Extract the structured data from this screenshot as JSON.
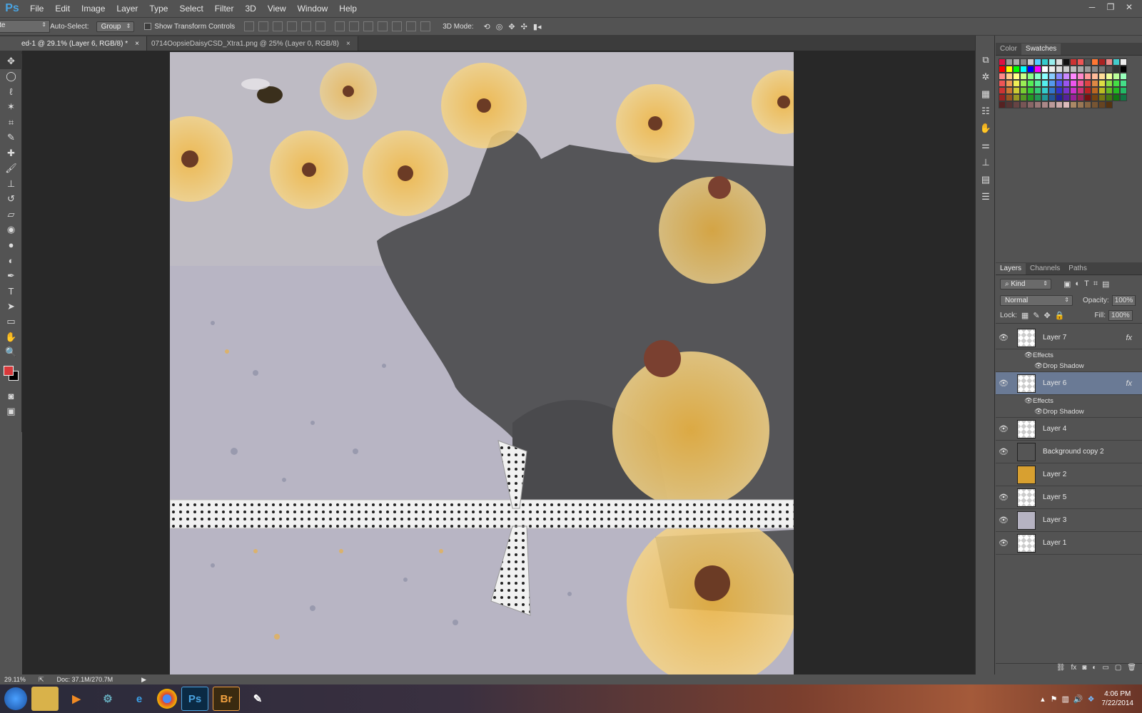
{
  "app": {
    "logo": "Ps"
  },
  "menu": [
    "File",
    "Edit",
    "Image",
    "Layer",
    "Type",
    "Select",
    "Filter",
    "3D",
    "View",
    "Window",
    "Help"
  ],
  "options": {
    "auto_select_label": "Auto-Select:",
    "auto_select_value": "Group",
    "transform_label": "Show Transform Controls",
    "mode_3d_label": "3D Mode:",
    "workspace": "Annette"
  },
  "tabs": [
    {
      "label": "ed-1 @ 29.1% (Layer 6, RGB/8) *"
    },
    {
      "label": "0714OopsieDaisyCSD_Xtra1.png @ 25% (Layer 0, RGB/8)"
    }
  ],
  "panels": {
    "color_tabs": [
      "Color",
      "Swatches"
    ],
    "layer_tabs": [
      "Layers",
      "Channels",
      "Paths"
    ],
    "filter_kind": "Kind",
    "blend_mode": "Normal",
    "opacity_label": "Opacity:",
    "opacity": "100%",
    "lock_label": "Lock:",
    "fill_label": "Fill:",
    "fill": "100%"
  },
  "layers": [
    {
      "name": "Layer 7",
      "visible": true,
      "fx": "fx",
      "effects_label": "Effects",
      "effect": "Drop Shadow"
    },
    {
      "name": "Layer 6",
      "visible": true,
      "selected": true,
      "fx": "fx",
      "effects_label": "Effects",
      "effect": "Drop Shadow"
    },
    {
      "name": "Layer 4",
      "visible": true
    },
    {
      "name": "Background copy 2",
      "visible": true
    },
    {
      "name": "Layer 2",
      "visible": false
    },
    {
      "name": "Layer 5",
      "visible": true
    },
    {
      "name": "Layer 3",
      "visible": true
    },
    {
      "name": "Layer 1",
      "visible": true
    }
  ],
  "status": {
    "zoom": "29.11%",
    "doc": "Doc: 37.1M/270.7M"
  },
  "taskbar": {
    "time": "4:06 PM",
    "date": "7/22/2014"
  },
  "colors": {
    "fg": "#d8383a",
    "bg": "#000000",
    "selection": "#6a7a95",
    "accent": "#4aa3e0"
  }
}
